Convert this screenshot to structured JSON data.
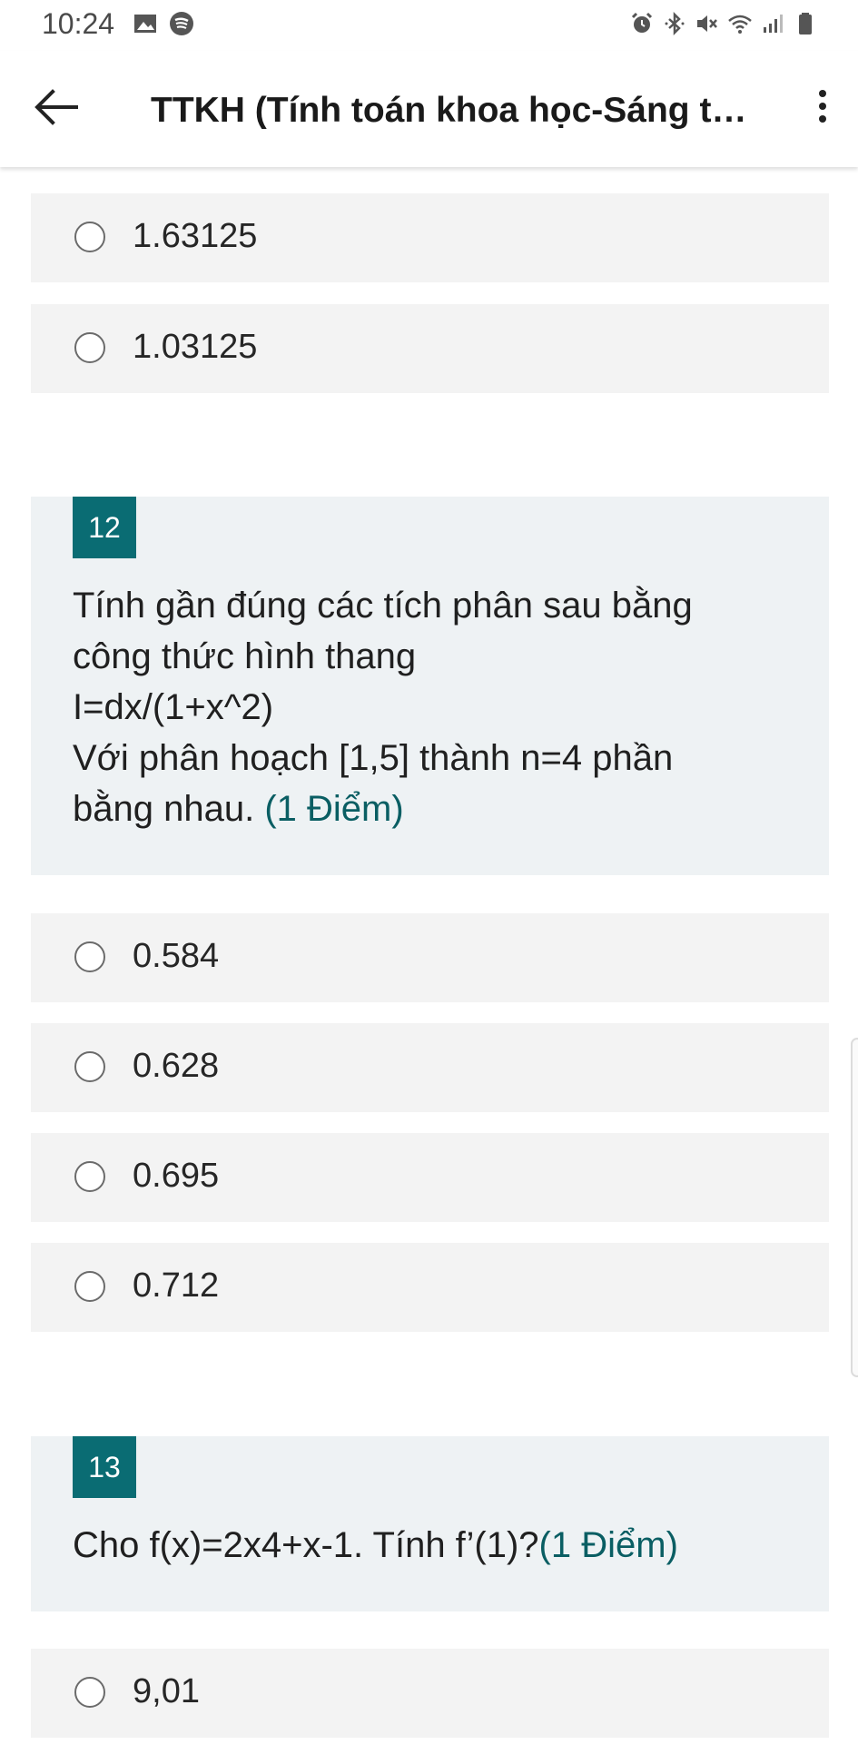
{
  "status_bar": {
    "time": "10:24",
    "icons": [
      "image-icon",
      "spotify-icon",
      "alarm-icon",
      "bluetooth-icon",
      "mute-icon",
      "wifi-icon",
      "signal-icon",
      "battery-icon"
    ]
  },
  "app_bar": {
    "title": "TTKH (Tính toán khoa học-Sáng th..."
  },
  "prev_options": [
    "1.63125",
    "1.03125"
  ],
  "q12": {
    "number": "12",
    "text_lines": [
      "Tính gần đúng các tích phân sau bằng",
      "công thức hình thang",
      "I=dx/(1+x^2)",
      "Với phân hoạch [1,5] thành n=4 phần",
      "bằng nhau."
    ],
    "points": "(1 Điểm)",
    "options": [
      "0.584",
      "0.628",
      "0.695",
      "0.712"
    ]
  },
  "q13": {
    "number": "13",
    "text": "Cho f(x)=2x4+x-1. Tính f’(1)?",
    "points": "(1 Điểm)",
    "options": [
      "9,01"
    ]
  },
  "colors": {
    "accent": "#0a6c73",
    "card_bg": "#eef2f4",
    "option_bg": "#f3f3f3"
  }
}
